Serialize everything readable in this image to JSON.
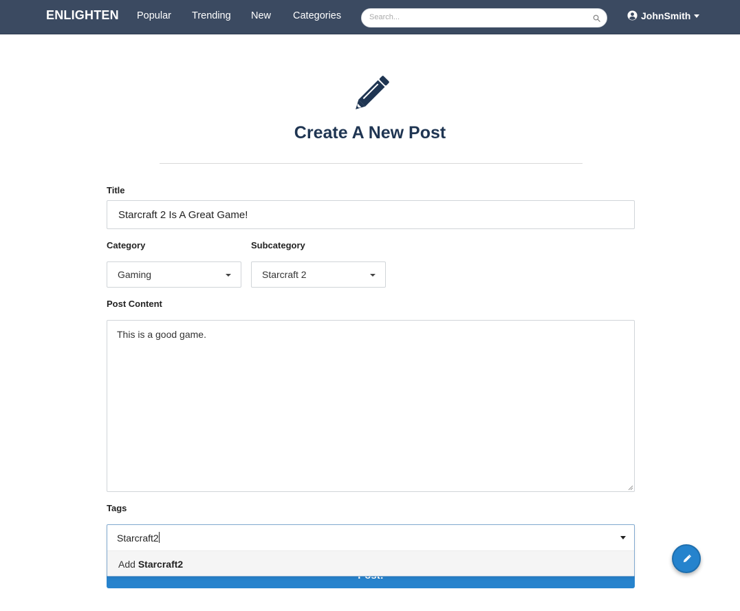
{
  "nav": {
    "brand": "ENLIGHTEN",
    "links": [
      "Popular",
      "Trending",
      "New",
      "Categories"
    ],
    "search_placeholder": "Search...",
    "user_name": "JohnSmith"
  },
  "header": {
    "title": "Create A New Post"
  },
  "form": {
    "title_label": "Title",
    "title_value": "Starcraft 2 Is A Great Game!",
    "category_label": "Category",
    "category_value": "Gaming",
    "subcategory_label": "Subcategory",
    "subcategory_value": "Starcraft 2",
    "content_label": "Post Content",
    "content_value": "This is a good game.",
    "tags_label": "Tags",
    "tags_value": "Starcraft2",
    "tags_option_prefix": "Add",
    "tags_option_value": "Starcraft2",
    "post_button": "Post!"
  },
  "colors": {
    "navbar": "#3b4a61",
    "title": "#1f3552",
    "primary": "#2783cd"
  }
}
